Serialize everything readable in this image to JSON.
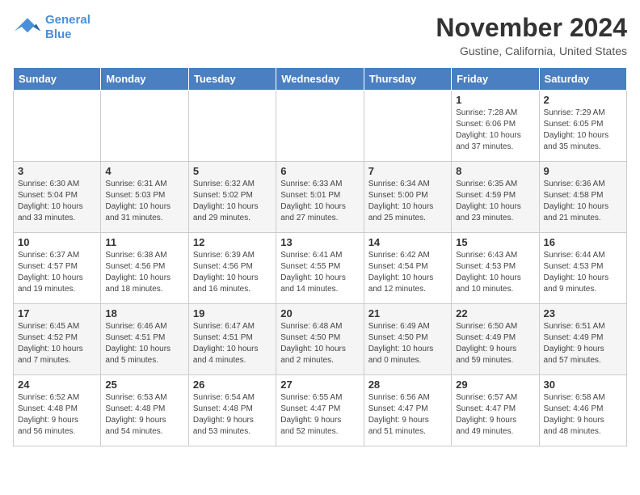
{
  "logo": {
    "line1": "General",
    "line2": "Blue"
  },
  "title": "November 2024",
  "subtitle": "Gustine, California, United States",
  "weekdays": [
    "Sunday",
    "Monday",
    "Tuesday",
    "Wednesday",
    "Thursday",
    "Friday",
    "Saturday"
  ],
  "weeks": [
    [
      {
        "day": "",
        "info": ""
      },
      {
        "day": "",
        "info": ""
      },
      {
        "day": "",
        "info": ""
      },
      {
        "day": "",
        "info": ""
      },
      {
        "day": "",
        "info": ""
      },
      {
        "day": "1",
        "info": "Sunrise: 7:28 AM\nSunset: 6:06 PM\nDaylight: 10 hours\nand 37 minutes."
      },
      {
        "day": "2",
        "info": "Sunrise: 7:29 AM\nSunset: 6:05 PM\nDaylight: 10 hours\nand 35 minutes."
      }
    ],
    [
      {
        "day": "3",
        "info": "Sunrise: 6:30 AM\nSunset: 5:04 PM\nDaylight: 10 hours\nand 33 minutes."
      },
      {
        "day": "4",
        "info": "Sunrise: 6:31 AM\nSunset: 5:03 PM\nDaylight: 10 hours\nand 31 minutes."
      },
      {
        "day": "5",
        "info": "Sunrise: 6:32 AM\nSunset: 5:02 PM\nDaylight: 10 hours\nand 29 minutes."
      },
      {
        "day": "6",
        "info": "Sunrise: 6:33 AM\nSunset: 5:01 PM\nDaylight: 10 hours\nand 27 minutes."
      },
      {
        "day": "7",
        "info": "Sunrise: 6:34 AM\nSunset: 5:00 PM\nDaylight: 10 hours\nand 25 minutes."
      },
      {
        "day": "8",
        "info": "Sunrise: 6:35 AM\nSunset: 4:59 PM\nDaylight: 10 hours\nand 23 minutes."
      },
      {
        "day": "9",
        "info": "Sunrise: 6:36 AM\nSunset: 4:58 PM\nDaylight: 10 hours\nand 21 minutes."
      }
    ],
    [
      {
        "day": "10",
        "info": "Sunrise: 6:37 AM\nSunset: 4:57 PM\nDaylight: 10 hours\nand 19 minutes."
      },
      {
        "day": "11",
        "info": "Sunrise: 6:38 AM\nSunset: 4:56 PM\nDaylight: 10 hours\nand 18 minutes."
      },
      {
        "day": "12",
        "info": "Sunrise: 6:39 AM\nSunset: 4:56 PM\nDaylight: 10 hours\nand 16 minutes."
      },
      {
        "day": "13",
        "info": "Sunrise: 6:41 AM\nSunset: 4:55 PM\nDaylight: 10 hours\nand 14 minutes."
      },
      {
        "day": "14",
        "info": "Sunrise: 6:42 AM\nSunset: 4:54 PM\nDaylight: 10 hours\nand 12 minutes."
      },
      {
        "day": "15",
        "info": "Sunrise: 6:43 AM\nSunset: 4:53 PM\nDaylight: 10 hours\nand 10 minutes."
      },
      {
        "day": "16",
        "info": "Sunrise: 6:44 AM\nSunset: 4:53 PM\nDaylight: 10 hours\nand 9 minutes."
      }
    ],
    [
      {
        "day": "17",
        "info": "Sunrise: 6:45 AM\nSunset: 4:52 PM\nDaylight: 10 hours\nand 7 minutes."
      },
      {
        "day": "18",
        "info": "Sunrise: 6:46 AM\nSunset: 4:51 PM\nDaylight: 10 hours\nand 5 minutes."
      },
      {
        "day": "19",
        "info": "Sunrise: 6:47 AM\nSunset: 4:51 PM\nDaylight: 10 hours\nand 4 minutes."
      },
      {
        "day": "20",
        "info": "Sunrise: 6:48 AM\nSunset: 4:50 PM\nDaylight: 10 hours\nand 2 minutes."
      },
      {
        "day": "21",
        "info": "Sunrise: 6:49 AM\nSunset: 4:50 PM\nDaylight: 10 hours\nand 0 minutes."
      },
      {
        "day": "22",
        "info": "Sunrise: 6:50 AM\nSunset: 4:49 PM\nDaylight: 9 hours\nand 59 minutes."
      },
      {
        "day": "23",
        "info": "Sunrise: 6:51 AM\nSunset: 4:49 PM\nDaylight: 9 hours\nand 57 minutes."
      }
    ],
    [
      {
        "day": "24",
        "info": "Sunrise: 6:52 AM\nSunset: 4:48 PM\nDaylight: 9 hours\nand 56 minutes."
      },
      {
        "day": "25",
        "info": "Sunrise: 6:53 AM\nSunset: 4:48 PM\nDaylight: 9 hours\nand 54 minutes."
      },
      {
        "day": "26",
        "info": "Sunrise: 6:54 AM\nSunset: 4:48 PM\nDaylight: 9 hours\nand 53 minutes."
      },
      {
        "day": "27",
        "info": "Sunrise: 6:55 AM\nSunset: 4:47 PM\nDaylight: 9 hours\nand 52 minutes."
      },
      {
        "day": "28",
        "info": "Sunrise: 6:56 AM\nSunset: 4:47 PM\nDaylight: 9 hours\nand 51 minutes."
      },
      {
        "day": "29",
        "info": "Sunrise: 6:57 AM\nSunset: 4:47 PM\nDaylight: 9 hours\nand 49 minutes."
      },
      {
        "day": "30",
        "info": "Sunrise: 6:58 AM\nSunset: 4:46 PM\nDaylight: 9 hours\nand 48 minutes."
      }
    ]
  ]
}
